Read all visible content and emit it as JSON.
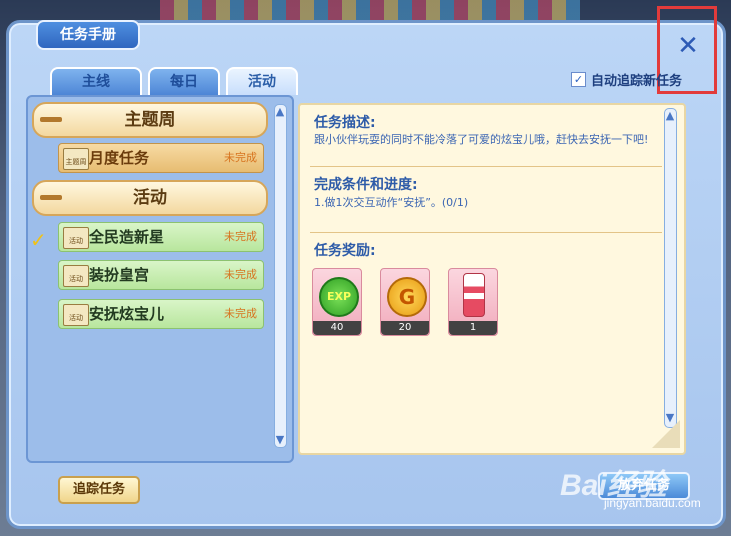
{
  "window": {
    "title": "任务手册"
  },
  "tabs": [
    {
      "label": "主线",
      "active": false
    },
    {
      "label": "每日",
      "active": false
    },
    {
      "label": "活动",
      "active": true
    }
  ],
  "auto_track": {
    "label": "自动追踪新任务",
    "checked": true
  },
  "categories": [
    {
      "label": "主题周"
    },
    {
      "label": "活动"
    }
  ],
  "quests": [
    {
      "icon_label": "主题周",
      "name": "月度任务",
      "status": "未完成",
      "style": "gold"
    },
    {
      "icon_label": "活动",
      "name": "全民造新星",
      "status": "未完成",
      "style": "green",
      "selected": true
    },
    {
      "icon_label": "活动",
      "name": "装扮皇宫",
      "status": "未完成",
      "style": "green"
    },
    {
      "icon_label": "活动",
      "name": "安抚炫宝儿",
      "status": "未完成",
      "style": "green"
    }
  ],
  "detail": {
    "desc_title": "任务描述:",
    "desc_text": "跟小伙伴玩耍的同时不能冷落了可爱的炫宝儿哦，赶快去安抚一下吧!",
    "progress_title": "完成条件和进度:",
    "progress_text": "1.做1次交互动作“安抚”。(0/1)",
    "reward_title": "任务奖励:",
    "rewards": [
      {
        "icon": "exp-badge-icon",
        "icon_text": "EXP",
        "count": "40"
      },
      {
        "icon": "gold-coin-icon",
        "icon_text": "G",
        "count": "20"
      },
      {
        "icon": "candle-icon",
        "icon_text": "",
        "count": "1"
      }
    ]
  },
  "buttons": {
    "track": "追踪任务",
    "accept": "放弃任务"
  },
  "watermark": {
    "text": "Bai经验",
    "sub": "jingyan.baidu.com"
  },
  "colors": {
    "highlight": "#e23b3b",
    "title_blue": "#2d5ba8",
    "status_orange": "#d7741f"
  }
}
